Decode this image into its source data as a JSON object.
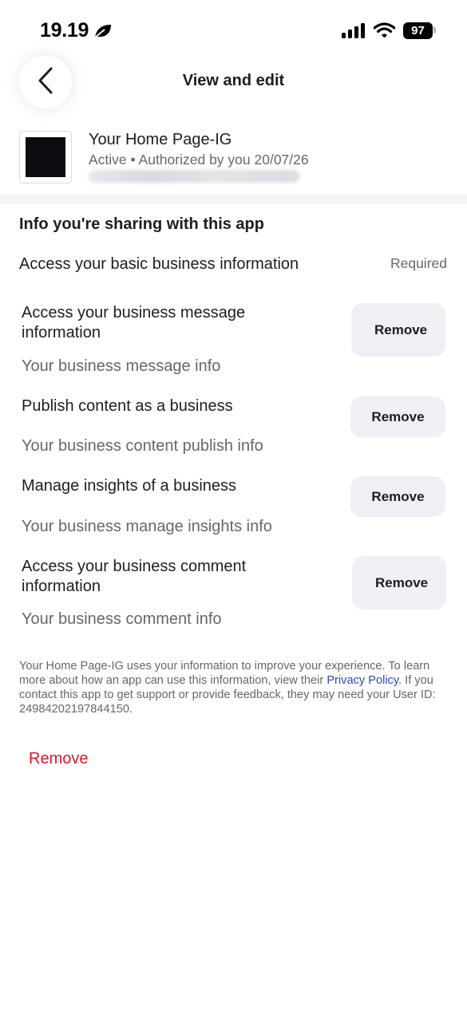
{
  "status": {
    "time": "19.19",
    "battery": "97",
    "icons": [
      "leaf-icon",
      "cellular-signal-icon",
      "wifi-icon",
      "battery-icon"
    ]
  },
  "header": {
    "back_icon": "chevron-left-icon",
    "title": "View and edit"
  },
  "app": {
    "name": "Your Home Page-IG",
    "status": "Active • Authorized by you 20/07/26"
  },
  "section": {
    "title": "Info you're sharing with this app",
    "basic_label": "Access your basic business information",
    "required_label": "Required"
  },
  "permissions": [
    {
      "label": "Access your business message information",
      "sub": "Your business message info",
      "button": "Remove"
    },
    {
      "label": "Publish content as a business",
      "sub": "Your business content publish info",
      "button": "Remove"
    },
    {
      "label": "Manage insights of a business",
      "sub": "Your business manage insights info",
      "button": "Remove"
    },
    {
      "label": "Access your business comment information",
      "sub": "Your business comment info",
      "button": "Remove"
    }
  ],
  "footer": {
    "text_before": "Your Home Page-IG uses your information to improve your experience. To learn more about how an app can use this information, view their ",
    "link": "Privacy Policy",
    "text_after": ". If you contact this app to get support or provide feedback, they may need your User ID: 24984202197844150."
  },
  "remove_all": "Remove",
  "colors": {
    "accent_link": "#2d4bb6",
    "danger": "#e0142a",
    "button_bg": "#eff0f4",
    "secondary_text": "#65676b"
  }
}
